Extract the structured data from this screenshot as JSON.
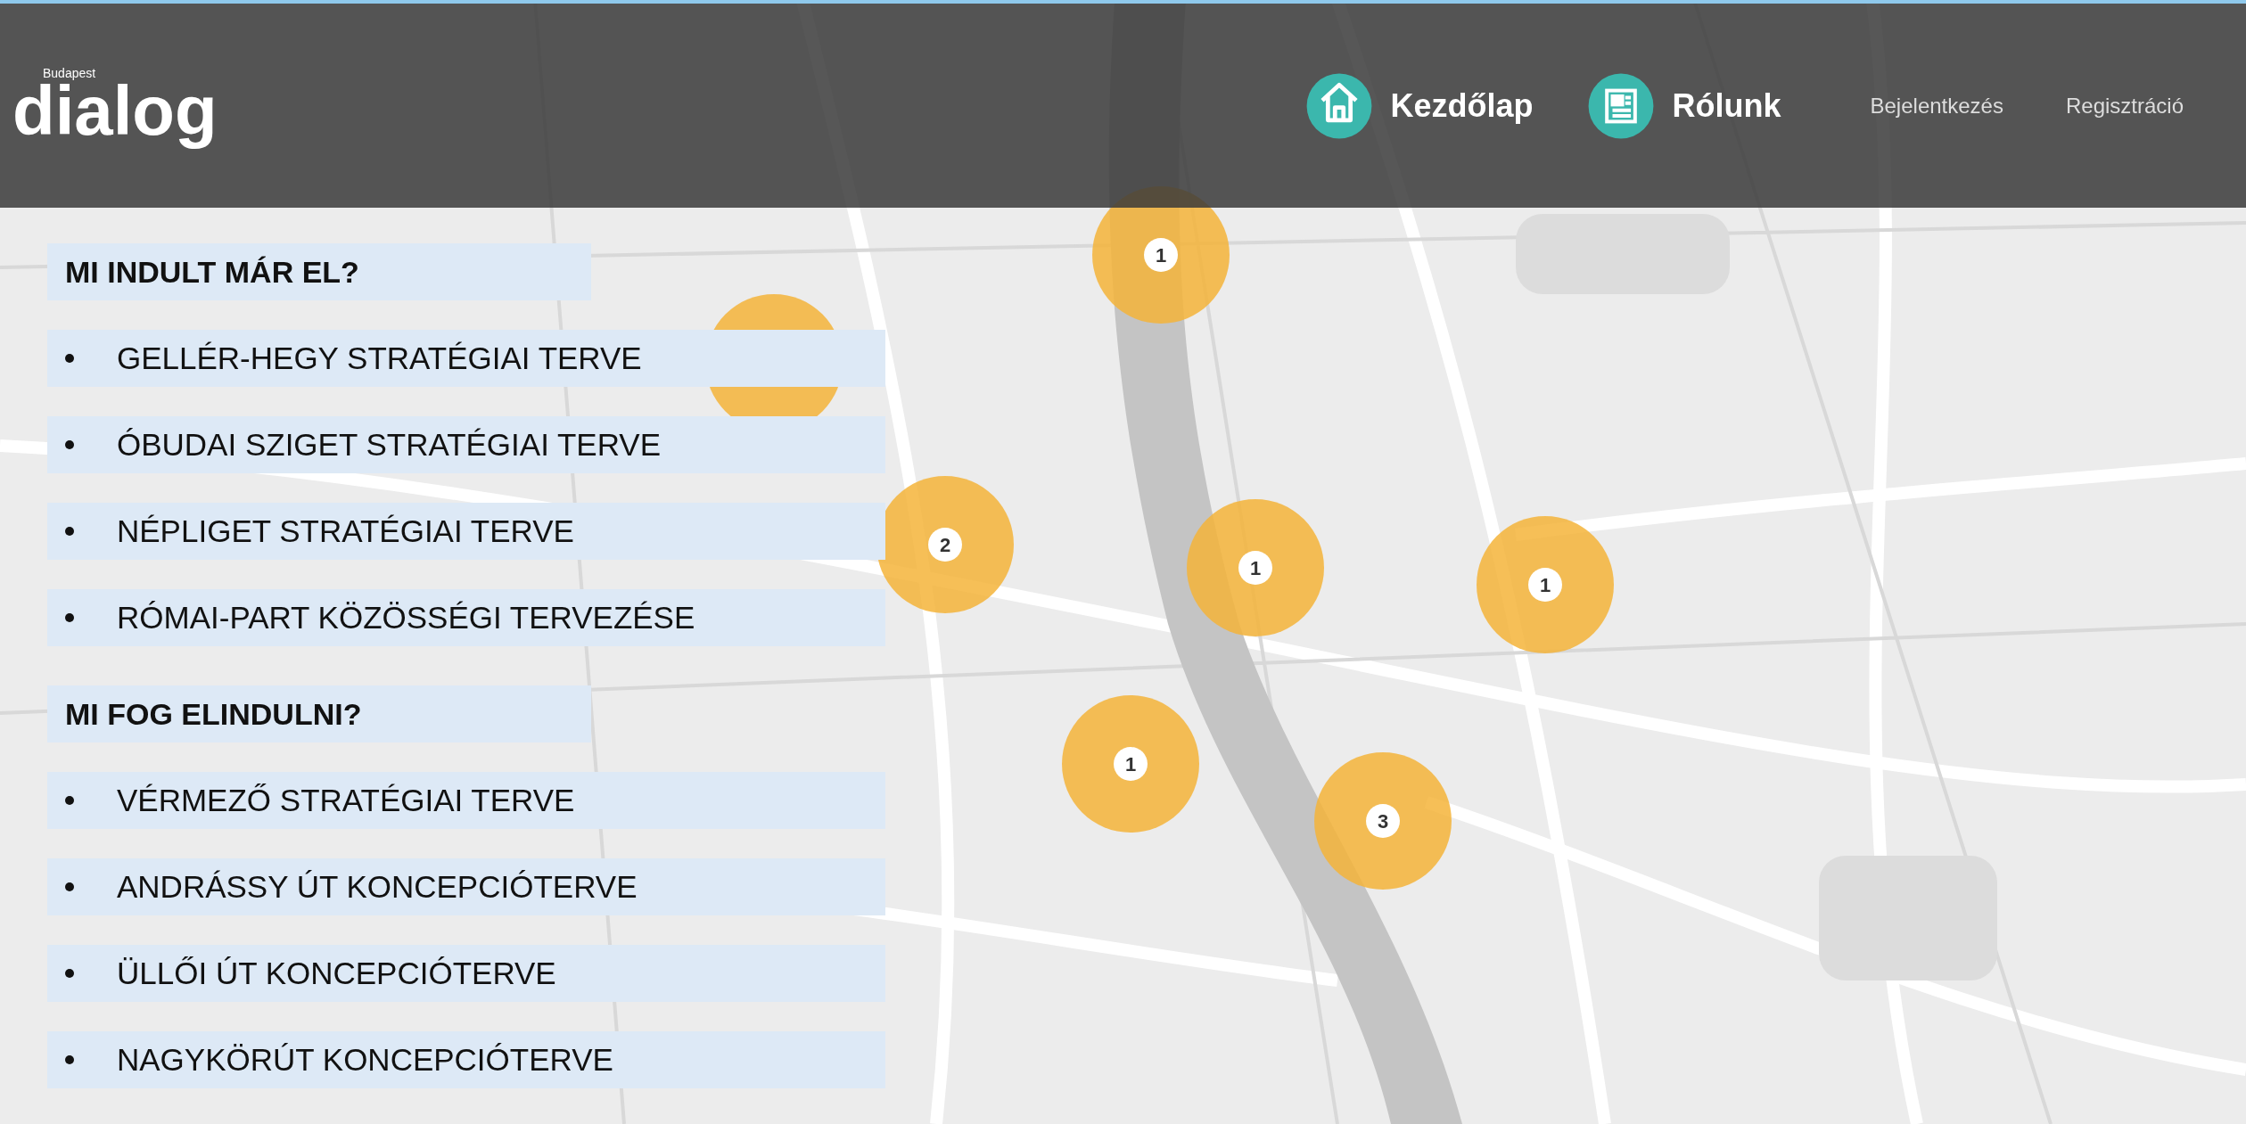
{
  "header": {
    "logo": {
      "small": "Budapest",
      "main": "dialog"
    },
    "nav": [
      "Kezdőlap",
      "Rólunk"
    ],
    "auth_links": [
      "Bejelentkezés",
      "Regisztráció"
    ]
  },
  "sections": [
    {
      "heading": "MI INDULT MÁR EL?",
      "items": [
        "GELLÉR-HEGY STRATÉGIAI TERVE",
        "ÓBUDAI SZIGET STRATÉGIAI TERVE",
        "NÉPLIGET STRATÉGIAI TERVE",
        "RÓMAI-PART KÖZÖSSÉGI TERVEZÉSE"
      ]
    },
    {
      "heading": "MI FOG ELINDULNI?",
      "items": [
        "VÉRMEZŐ STRATÉGIAI TERVE",
        "ANDRÁSSY ÚT KONCEPCIÓTERVE",
        "ÜLLŐI ÚT KONCEPCIÓTERVE",
        "NAGYKÖRÚT KONCEPCIÓTERVE"
      ]
    }
  ],
  "map_markers": [
    "1",
    "2",
    "1",
    "1",
    "1",
    "3"
  ]
}
